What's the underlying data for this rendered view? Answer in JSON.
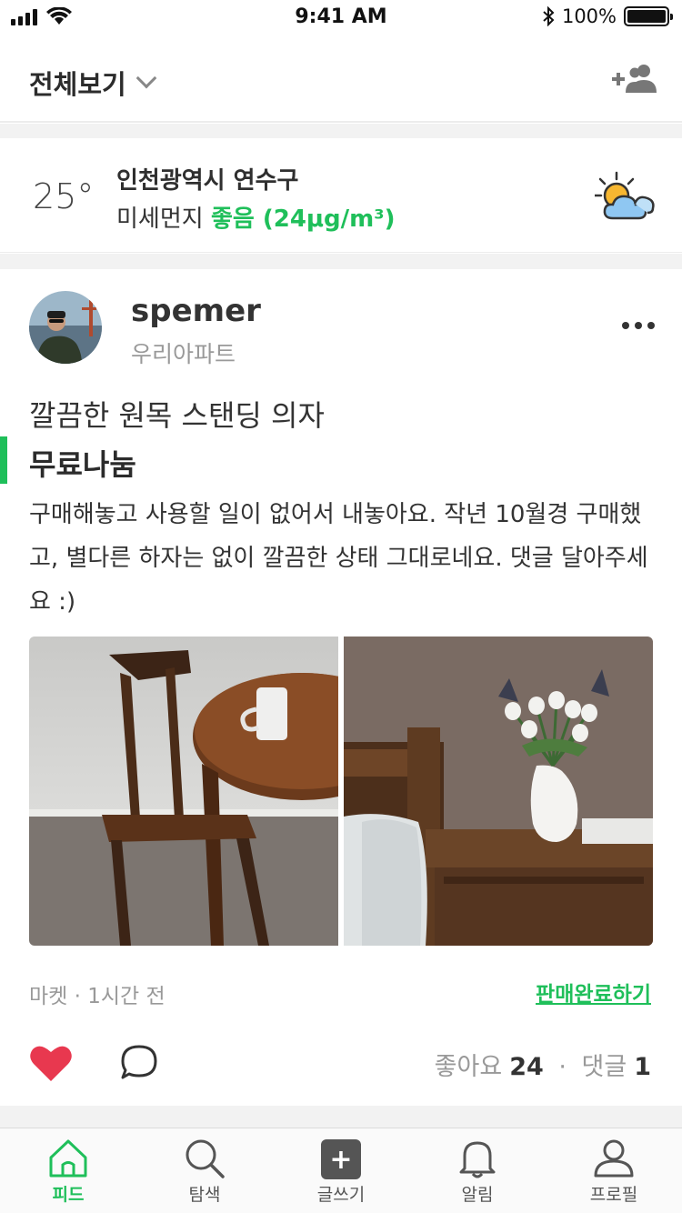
{
  "status_bar": {
    "time": "9:41 AM",
    "battery": "100%",
    "battery_level": 1.0,
    "icons": [
      "signal-icon",
      "wifi-icon",
      "bluetooth-icon",
      "battery-icon"
    ]
  },
  "header": {
    "title": "전체보기",
    "icons": [
      "chevron-down-icon",
      "add-friend-icon"
    ]
  },
  "weather": {
    "temperature": "25°",
    "location": "인천광역시 연수구",
    "dust_label": "미세먼지",
    "dust_status": "좋음 (24μg/m³)",
    "icon": "partly-cloudy-icon"
  },
  "post": {
    "username": "spemer",
    "apartment": "우리아파트",
    "title": "깔끔한 원목 스탠딩 의자",
    "price": "무료나눔",
    "body": "구매해놓고 사용할 일이 없어서 내놓아요. 작년 10월경 구매했고, 별다른 하자는 없이 깔끔한 상태 그대로네요. 댓글 달아주세요 :)",
    "category": "마켓",
    "time_ago": "1시간 전",
    "sold_action": "판매완료하기",
    "likes_label": "좋아요",
    "likes_count": "24",
    "comments_label": "댓글",
    "comments_count": "1"
  },
  "tabbar": {
    "tabs": [
      {
        "label": "피드",
        "icon": "home-icon",
        "active": true
      },
      {
        "label": "탐색",
        "icon": "search-icon",
        "active": false
      },
      {
        "label": "글쓰기",
        "icon": "write-icon",
        "active": false
      },
      {
        "label": "알림",
        "icon": "bell-icon",
        "active": false
      },
      {
        "label": "프로필",
        "icon": "profile-icon",
        "active": false
      }
    ]
  },
  "colors": {
    "accent": "#1fbf5a",
    "like": "#e8384f",
    "text": "#333333",
    "muted": "#999999"
  }
}
